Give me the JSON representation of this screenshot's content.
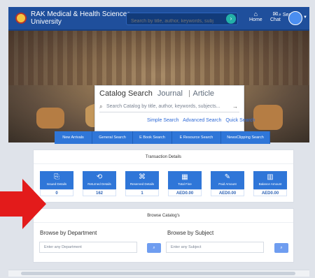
{
  "header": {
    "brand": "RAK Medical & Health Sciences University",
    "search_placeholder": "Search by title, author, keywords, subjects",
    "nav": {
      "home": "Home",
      "chat": "Chat",
      "search": "Search"
    }
  },
  "hero": {
    "catalog_title": "Catalog Search",
    "tabs": [
      "Journal",
      "Article"
    ],
    "input_placeholder": "Search Catalog by title, author, keywords, subjects...",
    "links": [
      "Simple Search",
      "Advanced Search",
      "Quick Search"
    ]
  },
  "tabbar": [
    "New Arrivals",
    "General Search",
    "E Book Search",
    "E Resource Search",
    "NewsClipping Search"
  ],
  "transaction": {
    "title": "Transaction Details",
    "cards": [
      {
        "label": "Issued Details",
        "value": "0"
      },
      {
        "label": "Returned Details",
        "value": "162"
      },
      {
        "label": "Reserved Details",
        "value": "1"
      },
      {
        "label": "Total Fine",
        "value": "AED0.00"
      },
      {
        "label": "Paid Amount",
        "value": "AED0.00"
      },
      {
        "label": "Balance Amount",
        "value": "AED0.00"
      }
    ]
  },
  "browse": {
    "title": "Browse Catalog's",
    "dept_title": "Browse by Department",
    "subj_title": "Browse by Subject",
    "dept_placeholder": "Enter any Department",
    "subj_placeholder": "Enter any Subject"
  },
  "colors": {
    "brand_blue": "#1f4f9c",
    "accent_blue": "#2f76d8",
    "arrow_red": "#e31b1b"
  }
}
